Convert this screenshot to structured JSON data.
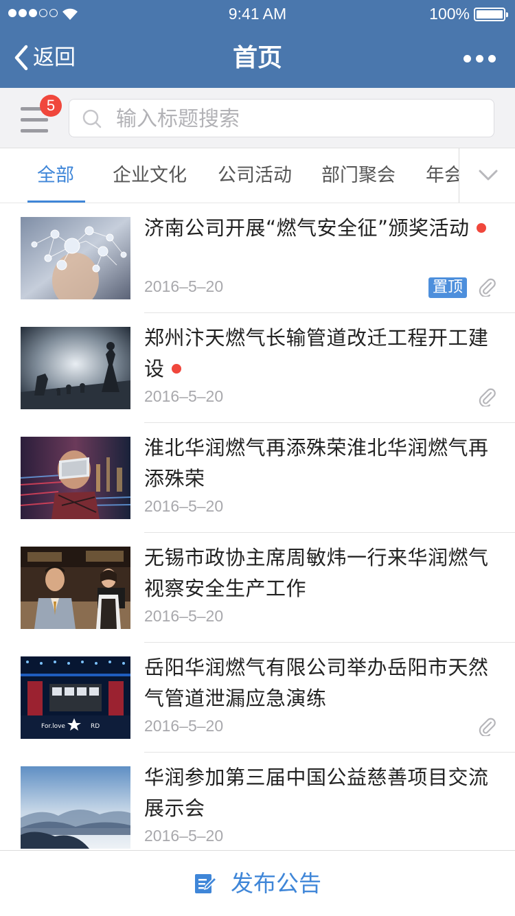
{
  "status_bar": {
    "time": "9:41 AM",
    "battery": "100%",
    "signal_bars_filled": 3,
    "signal_bars_total": 5
  },
  "nav": {
    "back_label": "返回",
    "title": "首页"
  },
  "search": {
    "badge_count": "5",
    "placeholder": "输入标题搜索"
  },
  "tabs": {
    "items": [
      {
        "label": "全部",
        "active": true
      },
      {
        "label": "企业文化",
        "active": false
      },
      {
        "label": "公司活动",
        "active": false
      },
      {
        "label": "部门聚会",
        "active": false
      },
      {
        "label": "年会",
        "active": false
      }
    ]
  },
  "articles": [
    {
      "title": "济南公司开展“燃气安全征”颁奖活动",
      "date": "2016–5–20",
      "unread": true,
      "pinned": true,
      "pin_label": "置顶",
      "attachment": true,
      "thumb": "network"
    },
    {
      "title": "郑州汴天燃气长输管道改迁工程开工建设",
      "date": "2016–5–20",
      "unread": true,
      "pinned": false,
      "attachment": true,
      "thumb": "chess"
    },
    {
      "title": "淮北华润燃气再添殊荣淮北华润燃气再添殊荣",
      "date": "2016–5–20",
      "unread": false,
      "pinned": false,
      "attachment": false,
      "thumb": "vr"
    },
    {
      "title": "无锡市政协主席周敏炜一行来华润燃气视察安全生产工作",
      "date": "2016–5–20",
      "unread": false,
      "pinned": false,
      "attachment": false,
      "thumb": "people"
    },
    {
      "title": "岳阳华润燃气有限公司举办岳阳市天然气管道泄漏应急演练",
      "date": "2016–5–20",
      "unread": false,
      "pinned": false,
      "attachment": true,
      "thumb": "stage",
      "thumb_text": "For.love"
    },
    {
      "title": "华润参加第三届中国公益慈善项目交流展示会",
      "date": "2016–5–20",
      "unread": false,
      "pinned": false,
      "attachment": false,
      "thumb": "mountains"
    }
  ],
  "footer": {
    "publish_label": "发布公告"
  },
  "colors": {
    "header": "#4a77ad",
    "accent": "#3f86d8",
    "badge": "#f0473c",
    "pin_tag": "#4d8fdc"
  }
}
